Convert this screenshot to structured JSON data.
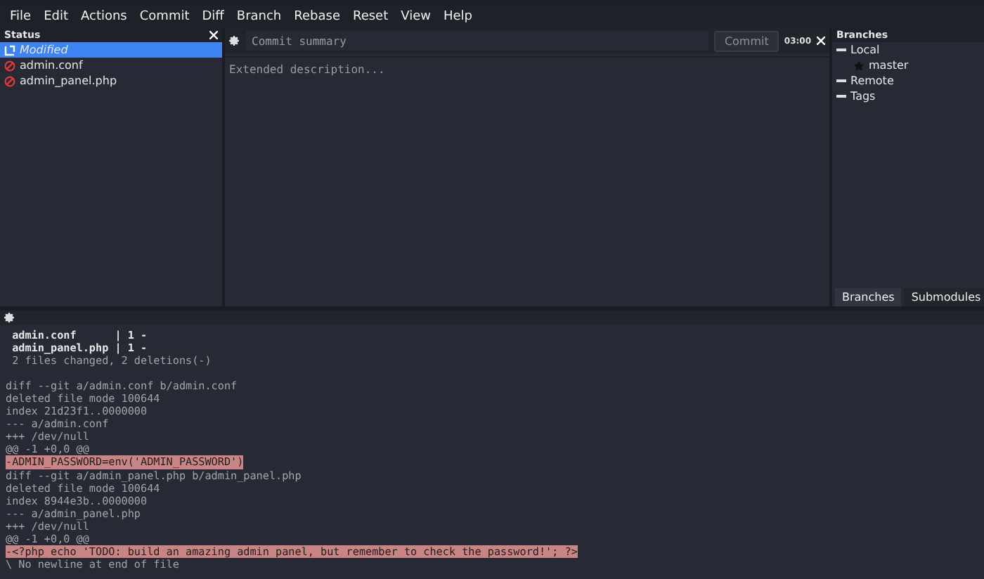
{
  "menu": [
    "File",
    "Edit",
    "Actions",
    "Commit",
    "Diff",
    "Branch",
    "Rebase",
    "Reset",
    "View",
    "Help"
  ],
  "status": {
    "title": "Status",
    "groups": [
      {
        "label": "Modified",
        "selected": true,
        "children": [
          {
            "label": "admin.conf",
            "selected": false
          },
          {
            "label": "admin_panel.php",
            "selected": false
          }
        ]
      }
    ]
  },
  "commit": {
    "summary_placeholder": "Commit summary",
    "button": "Commit",
    "time": "03:00",
    "description_placeholder": "Extended description..."
  },
  "branches": {
    "title": "Branches",
    "tree": [
      {
        "label": "Local",
        "expanded": true,
        "children": [
          {
            "label": "master",
            "kind": "current"
          }
        ]
      },
      {
        "label": "Remote",
        "expanded": true
      },
      {
        "label": "Tags",
        "expanded": true
      }
    ],
    "tabs": [
      {
        "label": "Branches",
        "selected": true
      },
      {
        "label": "Submodules",
        "selected": false
      }
    ]
  },
  "diff": [
    {
      "kind": "stat",
      "text": " admin.conf      | 1 -"
    },
    {
      "kind": "stat",
      "text": " admin_panel.php | 1 -"
    },
    {
      "kind": "plain",
      "text": " 2 files changed, 2 deletions(-)"
    },
    {
      "kind": "blank"
    },
    {
      "kind": "plain",
      "text": "diff --git a/admin.conf b/admin.conf"
    },
    {
      "kind": "plain",
      "text": "deleted file mode 100644"
    },
    {
      "kind": "plain",
      "text": "index 21d23f1..0000000"
    },
    {
      "kind": "plain",
      "text": "--- a/admin.conf"
    },
    {
      "kind": "plain",
      "text": "+++ /dev/null"
    },
    {
      "kind": "plain",
      "text": "@@ -1 +0,0 @@"
    },
    {
      "kind": "removed",
      "text": "-ADMIN_PASSWORD=env('ADMIN_PASSWORD')"
    },
    {
      "kind": "plain",
      "text": "diff --git a/admin_panel.php b/admin_panel.php"
    },
    {
      "kind": "plain",
      "text": "deleted file mode 100644"
    },
    {
      "kind": "plain",
      "text": "index 8944e3b..0000000"
    },
    {
      "kind": "plain",
      "text": "--- a/admin_panel.php"
    },
    {
      "kind": "plain",
      "text": "+++ /dev/null"
    },
    {
      "kind": "plain",
      "text": "@@ -1 +0,0 @@"
    },
    {
      "kind": "removed",
      "text": "-<?php echo 'TODO: build an amazing admin panel, but remember to check the password!'; ?>"
    },
    {
      "kind": "plain",
      "text": "\\ No newline at end of file"
    }
  ]
}
